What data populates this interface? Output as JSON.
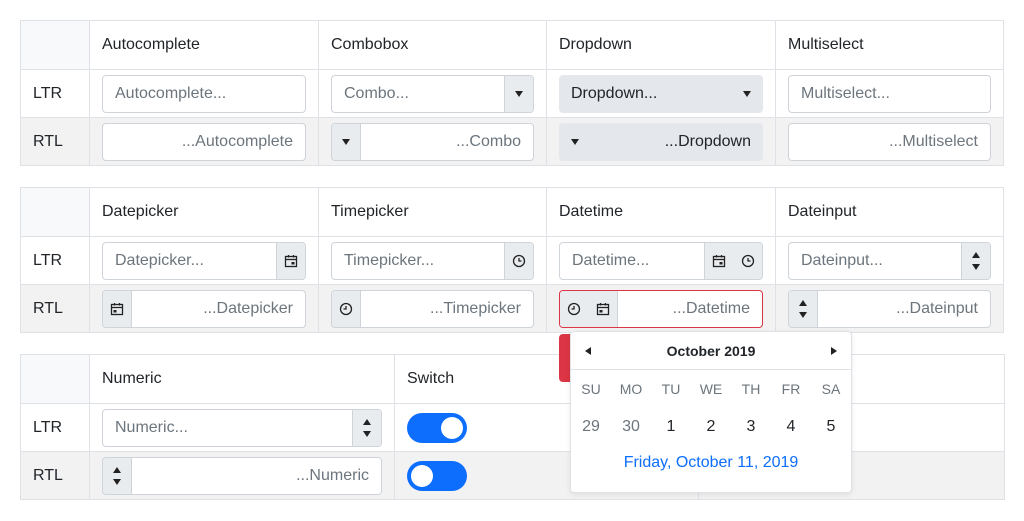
{
  "row_labels": {
    "ltr": "LTR",
    "rtl": "RTL"
  },
  "table1": {
    "headers": [
      "Autocomplete",
      "Combobox",
      "Dropdown",
      "Multiselect"
    ],
    "ltr": {
      "autocomplete": "Autocomplete...",
      "combobox": "Combo...",
      "dropdown": "Dropdown...",
      "multiselect": "Multiselect..."
    },
    "rtl": {
      "autocomplete": "...Autocomplete",
      "combobox": "...Combo",
      "dropdown": "...Dropdown",
      "multiselect": "...Multiselect"
    }
  },
  "table2": {
    "headers": [
      "Datepicker",
      "Timepicker",
      "Datetime",
      "Dateinput"
    ],
    "ltr": {
      "datepicker": "Datepicker...",
      "timepicker": "Timepicker...",
      "datetime": "Datetime...",
      "dateinput": "Dateinput..."
    },
    "rtl": {
      "datepicker": "...Datepicker",
      "timepicker": "...Timepicker",
      "datetime": "...Datetime",
      "dateinput": "...Dateinput"
    }
  },
  "table3": {
    "headers": [
      "Numeric",
      "Switch"
    ],
    "ltr": {
      "numeric": "Numeric..."
    },
    "rtl": {
      "numeric": "...Numeric"
    },
    "switch_ltr_on": true,
    "switch_rtl_on": false
  },
  "calendar": {
    "month_label": "October 2019",
    "weekdays": [
      "SU",
      "MO",
      "TU",
      "WE",
      "TH",
      "FR",
      "SA"
    ],
    "dates": [
      "29",
      "30",
      "1",
      "2",
      "3",
      "4",
      "5"
    ],
    "today_label": "Friday, October 11, 2019"
  },
  "colors": {
    "accent": "#0d6efd",
    "invalid": "#dc3545",
    "button_bg": "#e9ecef"
  },
  "icons": {
    "calendar": "calendar-icon",
    "clock": "clock-icon"
  }
}
